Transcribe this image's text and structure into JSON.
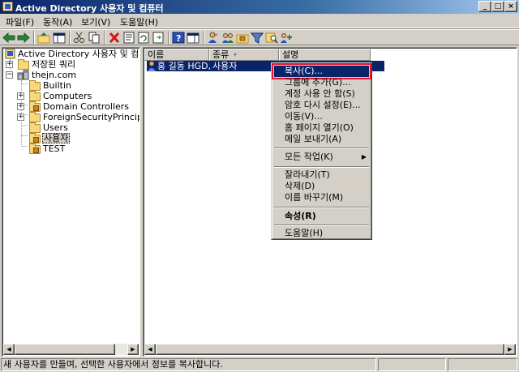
{
  "window": {
    "title": "Active Directory 사용자 및 컴퓨터"
  },
  "menu": {
    "items": [
      "파일(F)",
      "동작(A)",
      "보기(V)",
      "도움말(H)"
    ]
  },
  "tree": {
    "root": "Active Directory 사용자 및 컴퓨터",
    "saved_queries": "저장된 쿼리",
    "domain": "thejn.com",
    "children": [
      "Builtin",
      "Computers",
      "Domain Controllers",
      "ForeignSecurityPrincipals",
      "Users",
      "사용자",
      "TEST"
    ],
    "selected": "사용자"
  },
  "list": {
    "columns": [
      "이름",
      "종류",
      "설명"
    ],
    "rows": [
      {
        "name": "홍 길동 HGD,",
        "type": "사용자",
        "description": ""
      }
    ]
  },
  "context_menu": {
    "items": [
      "복사(C)...",
      "그룹에 추가(G)...",
      "계정 사용 안 함(S)",
      "암호 다시 설정(E)...",
      "이동(V)...",
      "홈 페이지 열기(O)",
      "메일 보내기(A)",
      "모든 작업(K)",
      "잘라내기(T)",
      "삭제(D)",
      "이름 바꾸기(M)",
      "속성(R)",
      "도움말(H)"
    ],
    "highlighted": "복사(C)...",
    "highlight_color": "#0a246a",
    "annotation_color": "#e8132f"
  },
  "status": {
    "text": "새 사용자를 만들며, 선택한 사용자에서 정보를 복사합니다."
  },
  "colors": {
    "selection": "#0a246a",
    "chrome": "#d4d0c8"
  }
}
